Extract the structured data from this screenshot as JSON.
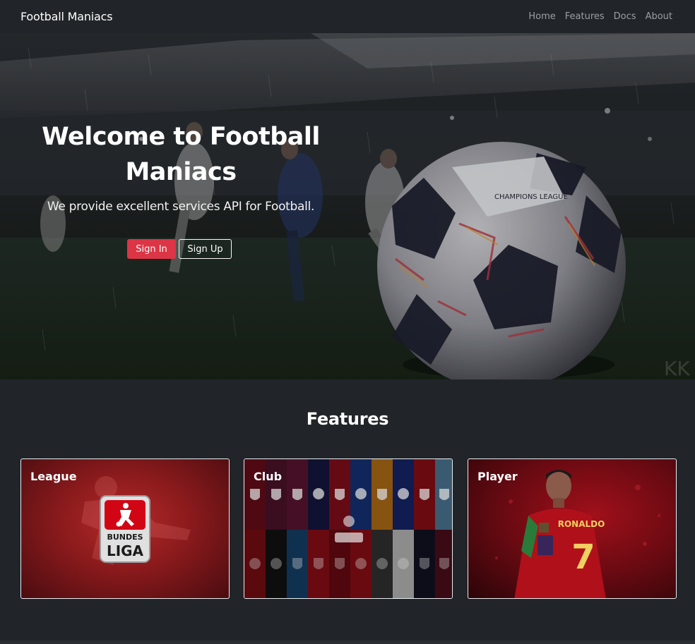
{
  "navbar": {
    "brand": "Football Maniacs",
    "links": [
      "Home",
      "Features",
      "Docs",
      "About"
    ]
  },
  "hero": {
    "title": "Welcome to Football Maniacs",
    "subtitle": "We provide excellent services API for Football.",
    "signin_label": "Sign In",
    "signup_label": "Sign Up",
    "ball_text": "CHAMPIONS LEAGUE",
    "watermark": "KK"
  },
  "features": {
    "heading": "Features",
    "cards": [
      {
        "title": "League",
        "logo_top": "BUNDES",
        "logo_bottom": "LIGA"
      },
      {
        "title": "Club"
      },
      {
        "title": "Player",
        "jersey_name": "RONALDO",
        "jersey_number": "7"
      }
    ]
  },
  "colors": {
    "background": "#212529",
    "accent_red": "#dc3545",
    "nav_link": "rgba(255,255,255,0.55)"
  }
}
